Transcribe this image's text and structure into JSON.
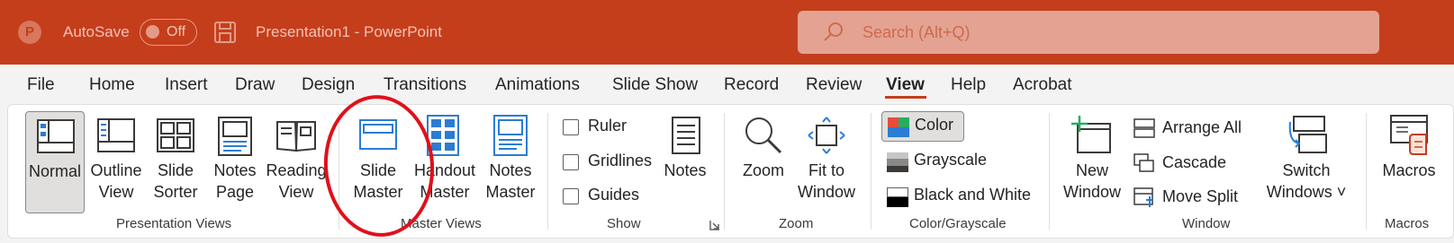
{
  "titlebar": {
    "autosave_label": "AutoSave",
    "autosave_state": "Off",
    "doc_title": "Presentation1  -  PowerPoint",
    "search_placeholder": "Search (Alt+Q)",
    "bg_color": "#c43e1c"
  },
  "menu": {
    "items": [
      "File",
      "Home",
      "Insert",
      "Draw",
      "Design",
      "Transitions",
      "Animations",
      "Slide Show",
      "Record",
      "Review",
      "View",
      "Help",
      "Acrobat"
    ],
    "active": "View"
  },
  "groups": {
    "presentation_views": {
      "label": "Presentation Views",
      "normal": "Normal",
      "outline_1": "Outline",
      "outline_2": "View",
      "sorter_1": "Slide",
      "sorter_2": "Sorter",
      "notes_1": "Notes",
      "notes_2": "Page",
      "reading_1": "Reading",
      "reading_2": "View"
    },
    "master_views": {
      "label": "Master Views",
      "slide_1": "Slide",
      "slide_2": "Master",
      "handout_1": "Handout",
      "handout_2": "Master",
      "notes_1": "Notes",
      "notes_2": "Master"
    },
    "show": {
      "label": "Show",
      "ruler": "Ruler",
      "gridlines": "Gridlines",
      "guides": "Guides",
      "notes": "Notes"
    },
    "zoom": {
      "label": "Zoom",
      "zoom": "Zoom",
      "fit_1": "Fit to",
      "fit_2": "Window"
    },
    "color": {
      "label": "Color/Grayscale",
      "color": "Color",
      "grayscale": "Grayscale",
      "bw": "Black and White"
    },
    "window": {
      "label": "Window",
      "new_1": "New",
      "new_2": "Window",
      "arrange_all": "Arrange All",
      "cascade": "Cascade",
      "move_split": "Move Split",
      "switch_1": "Switch",
      "switch_2": "Windows ˅"
    },
    "macros": {
      "label": "Macros",
      "macros": "Macros"
    }
  }
}
